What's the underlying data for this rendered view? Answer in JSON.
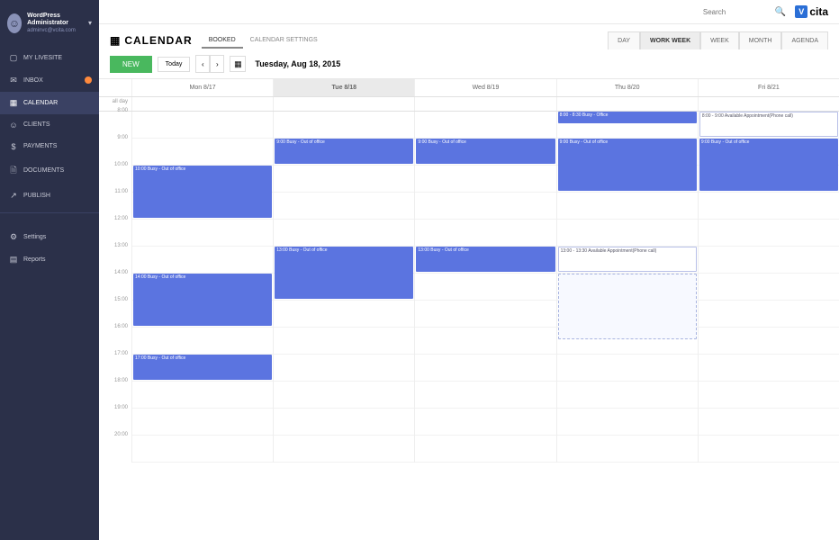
{
  "brand": {
    "name": "cita",
    "logo_letter": "V"
  },
  "search": {
    "placeholder": "Search"
  },
  "profile": {
    "name": "WordPress Administrator",
    "email": "adminvc@vcita.com"
  },
  "sidebar": {
    "items": [
      {
        "icon": "▢",
        "label": "MY LIVESITE",
        "badge": false
      },
      {
        "icon": "✉",
        "label": "INBOX",
        "badge": true
      },
      {
        "icon": "▦",
        "label": "CALENDAR",
        "badge": false,
        "active": true
      },
      {
        "icon": "☺",
        "label": "CLIENTS",
        "badge": false
      },
      {
        "icon": "$",
        "label": "PAYMENTS",
        "badge": false
      },
      {
        "icon": "🗎",
        "label": "DOCUMENTS",
        "badge": false
      },
      {
        "icon": "↗",
        "label": "PUBLISH",
        "badge": false
      }
    ],
    "footer": [
      {
        "icon": "⚙",
        "label": "Settings"
      },
      {
        "icon": "▤",
        "label": "Reports"
      }
    ]
  },
  "page": {
    "title": "CALENDAR",
    "tabs": [
      "BOOKED",
      "CALENDAR SETTINGS"
    ],
    "views": [
      "DAY",
      "WORK WEEK",
      "WEEK",
      "MONTH",
      "AGENDA"
    ],
    "active_view": "WORK WEEK"
  },
  "toolbar": {
    "new_label": "NEW",
    "today_label": "Today",
    "date_label": "Tuesday, Aug 18, 2015"
  },
  "calendar": {
    "allday_label": "all day",
    "days": [
      "Mon 8/17",
      "Tue 8/18",
      "Wed 8/19",
      "Thu 8/20",
      "Fri 8/21"
    ],
    "active_day": 1,
    "hours": [
      "8:00",
      "9:00",
      "10:00",
      "11:00",
      "12:00",
      "13:00",
      "14:00",
      "15:00",
      "16:00",
      "17:00",
      "18:00",
      "19:00",
      "20:00"
    ],
    "events": [
      {
        "day": 0,
        "start": 10,
        "dur": 2,
        "title": "10:00 Busy - Out of office",
        "type": "block"
      },
      {
        "day": 0,
        "start": 14,
        "dur": 2,
        "title": "14:00 Busy - Out of office",
        "type": "block"
      },
      {
        "day": 0,
        "start": 17,
        "dur": 1,
        "title": "17:00 Busy - Out of office",
        "type": "block"
      },
      {
        "day": 1,
        "start": 9,
        "dur": 1,
        "title": "9:00 Busy - Out of office",
        "type": "block"
      },
      {
        "day": 1,
        "start": 13,
        "dur": 2,
        "title": "13:00 Busy - Out of office",
        "type": "block"
      },
      {
        "day": 2,
        "start": 9,
        "dur": 1,
        "title": "9:00 Busy - Out of office",
        "type": "block"
      },
      {
        "day": 2,
        "start": 13,
        "dur": 1,
        "title": "13:00 Busy - Out of office",
        "type": "block"
      },
      {
        "day": 3,
        "start": 8,
        "dur": 0.5,
        "title": "8:00 - 8:30 Busy - Office",
        "type": "block"
      },
      {
        "day": 3,
        "start": 9,
        "dur": 2,
        "title": "9:00 Busy - Out of office",
        "type": "block"
      },
      {
        "day": 3,
        "start": 13,
        "dur": 1,
        "title": "13:00 - 13:30 Available Appointment(Phone call)",
        "type": "outline"
      },
      {
        "day": 3,
        "start": 14,
        "dur": 2.5,
        "title": "",
        "type": "dashed"
      },
      {
        "day": 4,
        "start": 8,
        "dur": 1,
        "title": "8:00 - 9:00 Available Appointment(Phone call)",
        "type": "outline"
      },
      {
        "day": 4,
        "start": 9,
        "dur": 2,
        "title": "9:00 Busy - Out of office",
        "type": "block"
      }
    ]
  }
}
